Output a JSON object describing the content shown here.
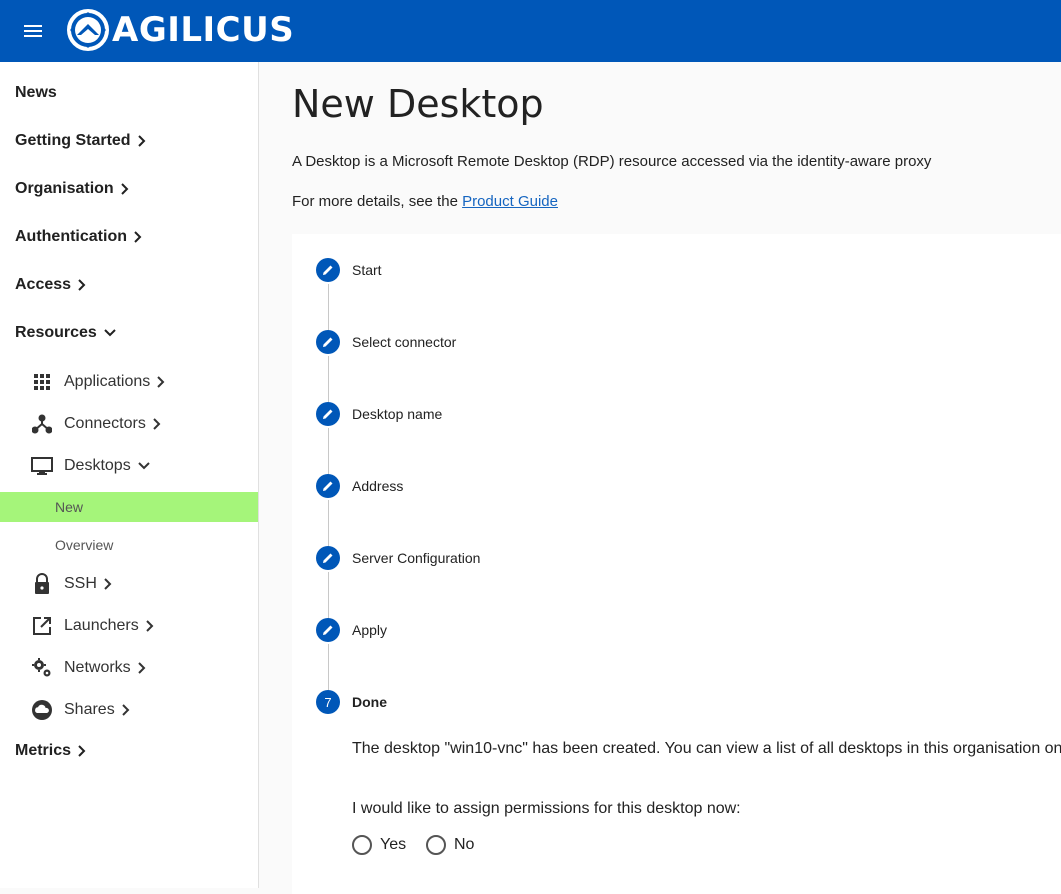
{
  "header": {
    "brand": "AGILICUS",
    "bg_color": "#0057b8"
  },
  "sidebar": {
    "news": "News",
    "getting_started": "Getting Started",
    "organisation": "Organisation",
    "authentication": "Authentication",
    "access": "Access",
    "resources": "Resources",
    "applications": "Applications",
    "connectors": "Connectors",
    "desktops": "Desktops",
    "new": "New",
    "overview": "Overview",
    "ssh": "SSH",
    "launchers": "Launchers",
    "networks": "Networks",
    "shares": "Shares",
    "metrics": "Metrics",
    "active_color": "#a5f57a"
  },
  "main": {
    "title": "New Desktop",
    "description": "A Desktop is a Microsoft Remote Desktop (RDP) resource accessed via the identity-aware proxy",
    "details_prefix": "For more details, see the ",
    "details_link": "Product Guide"
  },
  "stepper": {
    "steps": [
      {
        "label": "Start",
        "icon": "pencil-icon"
      },
      {
        "label": "Select connector",
        "icon": "pencil-icon"
      },
      {
        "label": "Desktop name",
        "icon": "pencil-icon"
      },
      {
        "label": "Address",
        "icon": "pencil-icon"
      },
      {
        "label": "Server Configuration",
        "icon": "pencil-icon"
      },
      {
        "label": "Apply",
        "icon": "pencil-icon"
      },
      {
        "label": "Done",
        "number": "7"
      }
    ],
    "done_message": "The desktop \"win10-vnc\" has been created. You can view a list of all desktops in this organisation on",
    "assign_question": "I would like to assign permissions for this desktop now:",
    "options": [
      "Yes",
      "No"
    ]
  }
}
